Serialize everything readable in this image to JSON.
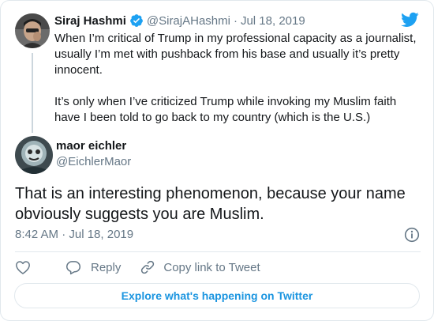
{
  "quoted_tweet": {
    "author_name": "Siraj Hashmi",
    "handle": "@SirajAHashmi",
    "separator": "·",
    "date": "Jul 18, 2019",
    "paragraphs": [
      "When I’m critical of Trump in my professional capacity as a journalist, usually I’m met with pushback from his base and usually it’s pretty innocent.",
      "It’s only when I’ve criticized Trump while invoking my Muslim faith have I been told to go back to my country (which is the U.S.)"
    ]
  },
  "reply_tweet": {
    "author_name": "maor eichler",
    "handle": "@EichlerMaor",
    "text": "That is an interesting phenomenon, because your name obviously suggests you are Muslim.",
    "timestamp": "8:42 AM · Jul 18, 2019"
  },
  "actions": {
    "reply_label": "Reply",
    "copy_link_label": "Copy link to Tweet"
  },
  "explore_button": {
    "label": "Explore what's happening on Twitter"
  },
  "colors": {
    "brand_blue": "#1da1f2",
    "link_blue": "#1b95e0",
    "muted_gray": "#657786",
    "border_gray": "#e1e8ed"
  },
  "icons": [
    "twitter-bird-icon",
    "verified-badge-icon",
    "info-icon",
    "heart-icon",
    "reply-bubble-icon",
    "link-icon"
  ]
}
